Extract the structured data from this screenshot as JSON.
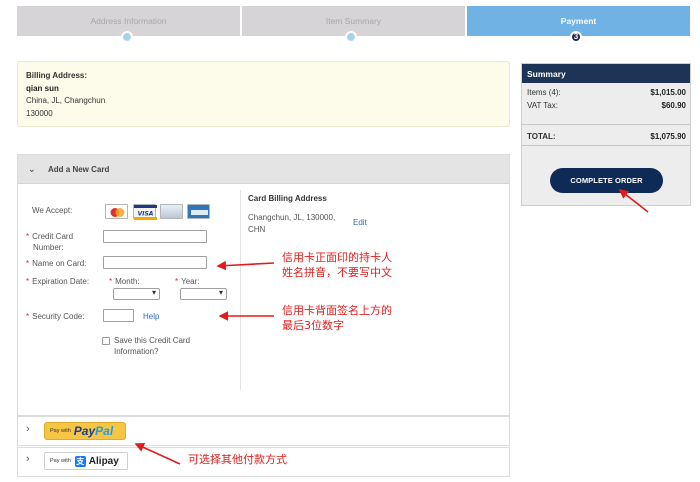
{
  "steps": [
    {
      "label": "Address Information",
      "state": "done"
    },
    {
      "label": "Item Summary",
      "state": "done"
    },
    {
      "label": "Payment",
      "state": "active",
      "number": "3"
    }
  ],
  "billing": {
    "label": "Billing Address:",
    "name": "qian sun",
    "line1": "China, JL, Changchun",
    "line2": "130000"
  },
  "card_section": {
    "title": "Add a New Card",
    "we_accept": "We Accept:",
    "card_icons": [
      "mastercard-icon",
      "visa-icon",
      "diners-icon",
      "amex-icon"
    ],
    "credit_card_number_line1": "Credit Card",
    "credit_card_number_line2": "Number:",
    "name_on_card": "Name on Card:",
    "expiration_date": "Expiration Date:",
    "month": "Month:",
    "year": "Year:",
    "security_code": "Security Code:",
    "help": "Help",
    "save_line1": "Save this Credit Card",
    "save_line2": "Information?",
    "card_billing_address_title": "Card Billing Address",
    "card_billing_address_line1": "Changchun, JL, 130000,",
    "card_billing_address_line2": "CHN",
    "edit": "Edit"
  },
  "paypal": {
    "small": "Pay with",
    "brand_a": "Pay",
    "brand_b": "Pal"
  },
  "alipay": {
    "small": "Pay with",
    "mark": "支",
    "brand": "Alipay"
  },
  "summary": {
    "title": "Summary",
    "items_label": "Items (4):",
    "items_value": "$1,015.00",
    "vat_label": "VAT Tax:",
    "vat_value": "$60.90",
    "total_label": "TOTAL:",
    "total_value": "$1,075.90",
    "complete_button": "COMPLETE ORDER"
  },
  "annotations": {
    "name_line1": "信用卡正面印的持卡人",
    "name_line2": "姓名拼音，不要写中文",
    "code_line1": "信用卡背面签名上方的",
    "code_line2": "最后3位数字",
    "other_payment": "可选择其他付款方式"
  },
  "colors": {
    "step_inactive": "#d7d4d8",
    "step_active": "#6fb2e3",
    "summary_header": "#1d3457",
    "complete_button": "#0e2b57",
    "annotation": "#e21c1c",
    "required": "#c0392b"
  }
}
